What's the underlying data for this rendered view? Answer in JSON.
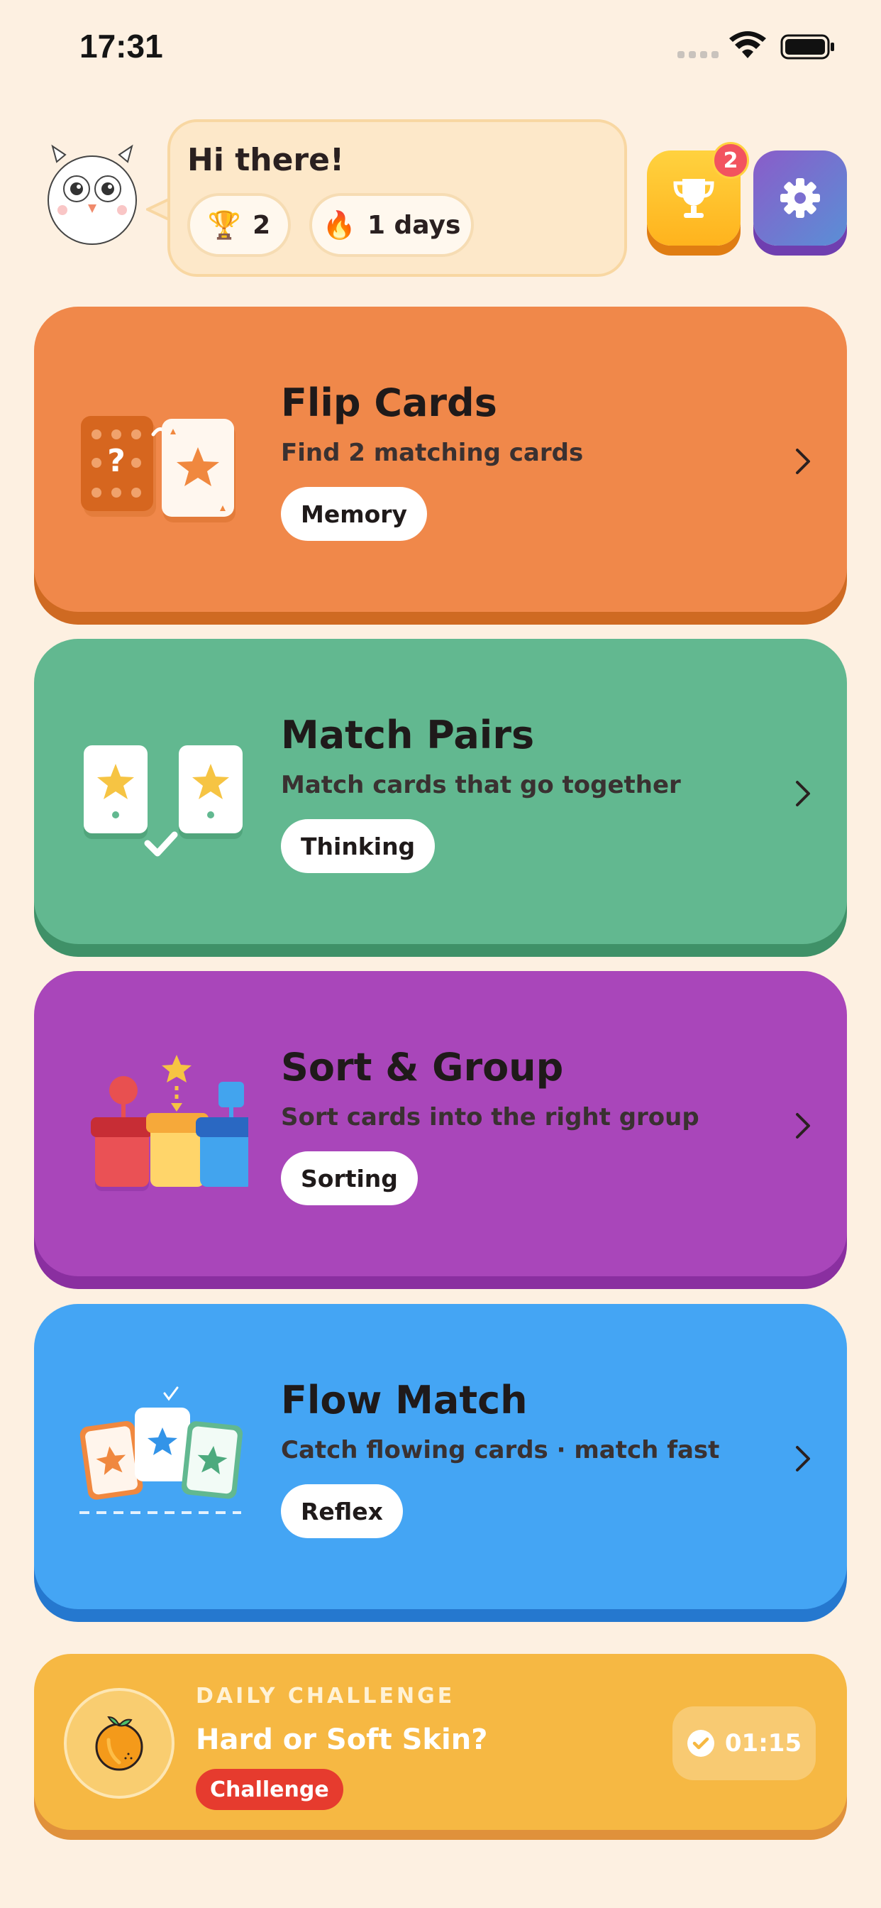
{
  "status_bar": {
    "time": "17:31"
  },
  "header": {
    "greeting": "Hi there!",
    "trophies": {
      "icon": "trophy-emoji",
      "emoji": "🏆",
      "value": "2"
    },
    "streak": {
      "icon": "fire-emoji",
      "emoji": "🔥",
      "value": "1 days"
    },
    "trophy_button": {
      "icon": "trophy-icon",
      "badge": "2"
    },
    "settings_button": {
      "icon": "gear-icon"
    }
  },
  "games": [
    {
      "title": "Flip Cards",
      "subtitle": "Find 2 matching cards",
      "tag": "Memory",
      "color": "#f0884a",
      "icon": "flip-cards-illustration"
    },
    {
      "title": "Match Pairs",
      "subtitle": "Match cards that go together",
      "tag": "Thinking",
      "color": "#62b890",
      "icon": "match-pairs-illustration"
    },
    {
      "title": "Sort & Group",
      "subtitle": "Sort cards into the right group",
      "tag": "Sorting",
      "color": "#a946ba",
      "icon": "sort-group-illustration"
    },
    {
      "title": "Flow Match",
      "subtitle": "Catch flowing cards · match fast",
      "tag": "Reflex",
      "color": "#44a5f4",
      "icon": "flow-match-illustration"
    }
  ],
  "daily_challenge": {
    "label": "DAILY CHALLENGE",
    "title": "Hard or Soft Skin?",
    "tag": "Challenge",
    "timer": "01:15",
    "icon": "orange-fruit-icon",
    "color": "#f6b843"
  }
}
